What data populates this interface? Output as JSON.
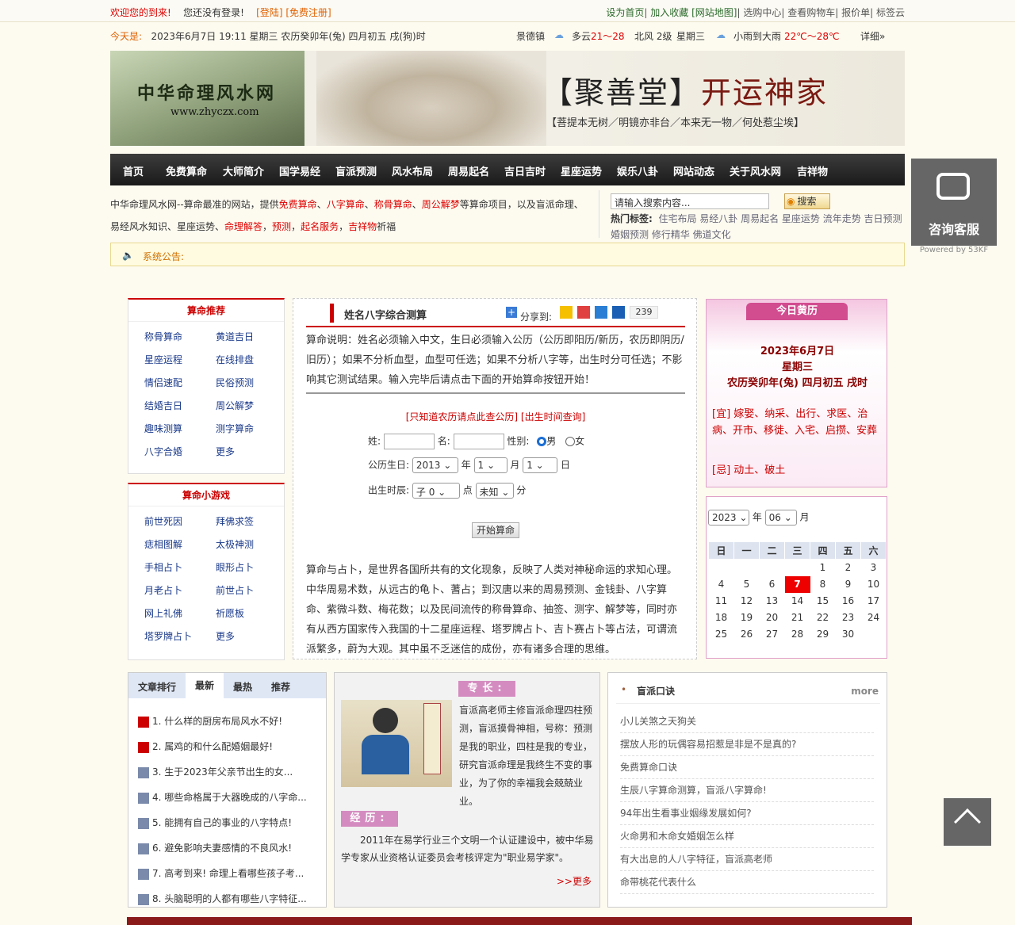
{
  "topbar": {
    "welcome": "欢迎您的到来!",
    "not_logged": "您还没有登录!",
    "login": "[登陆]",
    "register": "[免费注册]",
    "links": [
      "设为首页",
      "加入收藏",
      "[网站地图]",
      "选购中心",
      "查看购物车",
      "报价单",
      "标签云"
    ]
  },
  "daterow": {
    "label": "今天是:",
    "date": "2023年6月7日 19:11 星期三 农历癸卯年(兔) 四月初五 戌(狗)时",
    "city": "景德镇",
    "w1": "多云",
    "t1": "21～28",
    "wind": "北风 2级",
    "weekday": "星期三",
    "w2": "小雨到大雨",
    "t2": "22℃～28℃",
    "detail": "详细»"
  },
  "banner": {
    "logo_cn": "中华命理风水网",
    "logo_url": "www.zhyczx.com",
    "slogan_open": "【聚善堂】",
    "slogan": "开运神家",
    "poem": "【菩提本无树／明镜亦非台／本来无一物／何处惹尘埃】"
  },
  "nav": [
    "首页",
    "免费算命",
    "大师简介",
    "国学易经",
    "盲派预测",
    "风水布局",
    "周易起名",
    "吉日吉时",
    "星座运势",
    "娱乐八卦",
    "网站动态",
    "关于风水网",
    "吉祥物"
  ],
  "intro": {
    "p1": "中华命理风水网--算命最准的网站，提供",
    "k1": "免费算命",
    "k2": "八字算命",
    "k3": "称骨算命",
    "k4": "周公解梦",
    "p2": "等算命项目，以及盲派命理、",
    "p3": "易经风水知识、星座运势、",
    "k5": "命理解答",
    "k6": "预测",
    "k7": "起名服务",
    "k8": "吉祥物",
    "p4": "祈福"
  },
  "search": {
    "placeholder": "请输入搜索内容...",
    "button": "搜索",
    "hot_label": "热门标签:",
    "tags": "住宅布局 易经八卦 周易起名 星座运势 流年走势 吉日预测 婚姻预测 修行精华 佛道文化"
  },
  "notice": "系统公告:",
  "consult": {
    "label": "咨询客服",
    "powered": "Powered by 53KF"
  },
  "left1": {
    "title": "算命推荐",
    "items": [
      "称骨算命",
      "黄道吉日",
      "星座运程",
      "在线排盘",
      "情侣速配",
      "民俗预测",
      "结婚吉日",
      "周公解梦",
      "趣味测算",
      "测字算命",
      "八字合婚",
      "更多"
    ]
  },
  "left2": {
    "title": "算命小游戏",
    "items": [
      "前世死因",
      "拜佛求签",
      "痣相图解",
      "太极神测",
      "手相占卜",
      "眼形占卜",
      "月老占卜",
      "前世占卜",
      "网上礼佛",
      "祈愿板",
      "塔罗牌占卜",
      "更多"
    ]
  },
  "center": {
    "title": "姓名八字综合测算",
    "share": "分享到:",
    "count": "239",
    "desc": "算命说明：姓名必须输入中文，生日必须输入公历（公历即阳历/新历，农历即阴历/旧历）；如果不分析血型，血型可任选；如果不分析八字等，出生时分可任选；不影响其它测试结果。输入完毕后请点击下面的开始算命按钮开始！",
    "link": "[只知道农历请点此查公历] [出生时间查询]",
    "surname": "姓:",
    "name": "名:",
    "gender": "性别:",
    "male": "男",
    "female": "女",
    "birth": "公历生日:",
    "year": "2013",
    "year_u": "年",
    "month": "1",
    "month_u": "月",
    "day": "1",
    "day_u": "日",
    "btime": "出生时辰:",
    "hour": "子 0",
    "hour_u": "点",
    "minute": "未知",
    "minute_u": "分",
    "submit": "开始算命",
    "para": "算命与占卜，是世界各国所共有的文化现象，反映了人类对神秘命运的求知心理。中华周易术数，从远古的龟卜、蓍占；到汉唐以来的周易预测、金钱卦、八字算命、紫微斗数、梅花数；以及民间流传的称骨算命、抽签、测字、解梦等，同时亦有从西方国家传入我国的十二星座运程、塔罗牌占卜、吉卜赛占卜等占法，可谓流派繁多，蔚为大观。其中虽不乏迷信的成份，亦有诸多合理的思维。"
  },
  "almanac": {
    "tab": "今日黄历",
    "date": "2023年6月7日",
    "weekday": "星期三",
    "lunar": "农历癸卯年(兔) 四月初五 戌时",
    "yi": "[宜] 嫁娶、纳采、出行、求医、治病、开市、移徙、入宅、启攒、安葬",
    "ji": "[忌] 动土、破土"
  },
  "calendar": {
    "year": "2023",
    "year_u": "年",
    "month": "06",
    "month_u": "月",
    "week": [
      "日",
      "一",
      "二",
      "三",
      "四",
      "五",
      "六"
    ],
    "rows": [
      [
        "",
        "",
        "",
        "",
        "1",
        "2",
        "3"
      ],
      [
        "4",
        "5",
        "6",
        "7",
        "8",
        "9",
        "10"
      ],
      [
        "11",
        "12",
        "13",
        "14",
        "15",
        "16",
        "17"
      ],
      [
        "18",
        "19",
        "20",
        "21",
        "22",
        "23",
        "24"
      ],
      [
        "25",
        "26",
        "27",
        "28",
        "29",
        "30",
        ""
      ]
    ],
    "today": "7"
  },
  "articles": {
    "tabs": [
      "文章排行",
      "最新",
      "最热",
      "推荐"
    ],
    "items": [
      "1. 什么样的厨房布局风水不好!",
      "2. 属鸡的和什么配婚姻最好!",
      "3. 生于2023年父亲节出生的女...",
      "4. 哪些命格属于大器晚成的八字命...",
      "5. 能拥有自己的事业的八字特点!",
      "6. 避免影响夫妻感情的不良风水!",
      "7. 高考到来! 命理上看哪些孩子考...",
      "8. 头脑聪明的人都有哪些八字特征..."
    ]
  },
  "master": {
    "tag1": "专长:",
    "intro": "盲派高老师主修盲派命理四柱预测，盲派摸骨神相，号称：预测是我的职业，四柱是我的专业，研究盲派命理是我终生不变的事业，为了你的幸福我会兢兢业业。",
    "intro_name": "盲派高老师",
    "tag2": "经历:",
    "exp": "2011年在易学行业三个文明一个认证建设中，被中华易学专家从业资格认证委员会考核评定为\"职业易学家\"。",
    "more": ">>更多"
  },
  "secrets": {
    "title": "盲派口诀",
    "more": "more",
    "items": [
      "小儿关煞之天狗关",
      "摆放人形的玩偶容易招惹是非是不是真的?",
      "免费算命口诀",
      "生辰八字算命测算，盲派八字算命!",
      "94年出生看事业姻缘发展如何?",
      "火命男和木命女婚姻怎么样",
      "有大出息的人八字特征，盲派高老师",
      "命带桃花代表什么"
    ]
  }
}
